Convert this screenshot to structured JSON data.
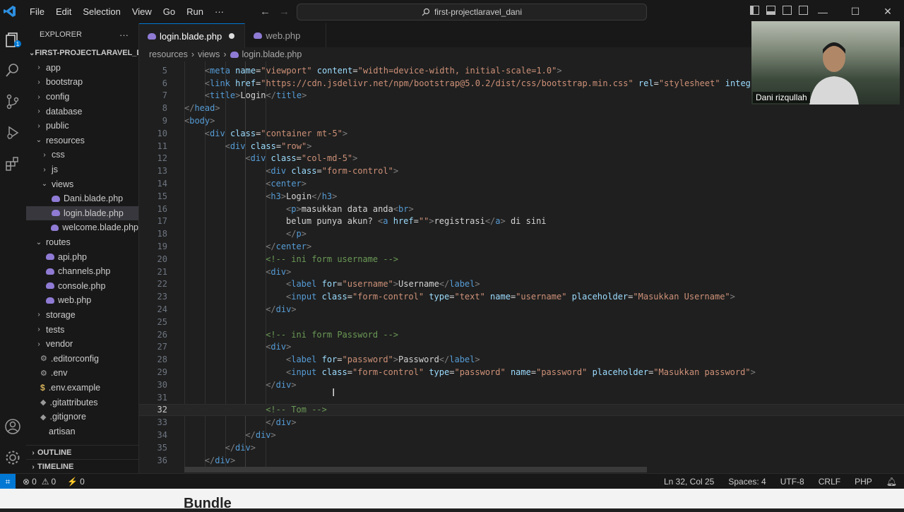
{
  "titlebar": {
    "menu": [
      "File",
      "Edit",
      "Selection",
      "View",
      "Go",
      "Run",
      "···"
    ],
    "search": "first-projectlaravel_dani"
  },
  "sidebar": {
    "title": "EXPLORER",
    "more": "···",
    "project": "FIRST-PROJECTLARAVEL_D...",
    "items": [
      {
        "label": "app",
        "indent": 1,
        "kind": "folder",
        "open": false
      },
      {
        "label": "bootstrap",
        "indent": 1,
        "kind": "folder",
        "open": false
      },
      {
        "label": "config",
        "indent": 1,
        "kind": "folder",
        "open": false
      },
      {
        "label": "database",
        "indent": 1,
        "kind": "folder",
        "open": false
      },
      {
        "label": "public",
        "indent": 1,
        "kind": "folder",
        "open": false
      },
      {
        "label": "resources",
        "indent": 1,
        "kind": "folder",
        "open": true
      },
      {
        "label": "css",
        "indent": 2,
        "kind": "folder",
        "open": false
      },
      {
        "label": "js",
        "indent": 2,
        "kind": "folder",
        "open": false
      },
      {
        "label": "views",
        "indent": 2,
        "kind": "folder",
        "open": true
      },
      {
        "label": "Dani.blade.php",
        "indent": 3,
        "kind": "php"
      },
      {
        "label": "login.blade.php",
        "indent": 3,
        "kind": "php",
        "selected": true
      },
      {
        "label": "welcome.blade.php",
        "indent": 3,
        "kind": "php"
      },
      {
        "label": "routes",
        "indent": 1,
        "kind": "folder",
        "open": true
      },
      {
        "label": "api.php",
        "indent": 2,
        "kind": "php"
      },
      {
        "label": "channels.php",
        "indent": 2,
        "kind": "php"
      },
      {
        "label": "console.php",
        "indent": 2,
        "kind": "php"
      },
      {
        "label": "web.php",
        "indent": 2,
        "kind": "php"
      },
      {
        "label": "storage",
        "indent": 1,
        "kind": "folder",
        "open": false
      },
      {
        "label": "tests",
        "indent": 1,
        "kind": "folder",
        "open": false
      },
      {
        "label": "vendor",
        "indent": 1,
        "kind": "folder",
        "open": false
      },
      {
        "label": ".editorconfig",
        "indent": 1,
        "kind": "gear"
      },
      {
        "label": ".env",
        "indent": 1,
        "kind": "gear"
      },
      {
        "label": ".env.example",
        "indent": 1,
        "kind": "dollar"
      },
      {
        "label": ".gitattributes",
        "indent": 1,
        "kind": "git"
      },
      {
        "label": ".gitignore",
        "indent": 1,
        "kind": "git"
      },
      {
        "label": "artisan",
        "indent": 1,
        "kind": "plain"
      }
    ],
    "outline": "OUTLINE",
    "timeline": "TIMELINE"
  },
  "tabs": [
    {
      "label": "login.blade.php",
      "active": true,
      "modified": true
    },
    {
      "label": "web.php",
      "active": false,
      "modified": false
    }
  ],
  "breadcrumb": [
    "resources",
    "views",
    "login.blade.php"
  ],
  "code": [
    {
      "n": "5",
      "indent": 1,
      "tokens": [
        [
          "br",
          "<"
        ],
        [
          "tg",
          "meta "
        ],
        [
          "at",
          "name"
        ],
        [
          "eq",
          "="
        ],
        [
          "st",
          "\"viewport\" "
        ],
        [
          "at",
          "content"
        ],
        [
          "eq",
          "="
        ],
        [
          "st",
          "\"width=device-width, initial-scale=1.0\""
        ],
        [
          "br",
          ">"
        ]
      ]
    },
    {
      "n": "6",
      "indent": 1,
      "tokens": [
        [
          "br",
          "<"
        ],
        [
          "tg",
          "link "
        ],
        [
          "at",
          "href"
        ],
        [
          "eq",
          "="
        ],
        [
          "st",
          "\"https://cdn.jsdelivr.net/npm/bootstrap@5.0.2/dist/css/bootstrap.min.css\" "
        ],
        [
          "at",
          "rel"
        ],
        [
          "eq",
          "="
        ],
        [
          "st",
          "\"stylesheet\" "
        ],
        [
          "at",
          "integ"
        ]
      ]
    },
    {
      "n": "7",
      "indent": 1,
      "tokens": [
        [
          "br",
          "<"
        ],
        [
          "tg",
          "title"
        ],
        [
          "br",
          ">"
        ],
        [
          "txt",
          "Login"
        ],
        [
          "br",
          "</"
        ],
        [
          "tg",
          "title"
        ],
        [
          "br",
          ">"
        ]
      ]
    },
    {
      "n": "8",
      "indent": 0,
      "tokens": [
        [
          "br",
          "</"
        ],
        [
          "tg",
          "head"
        ],
        [
          "br",
          ">"
        ]
      ]
    },
    {
      "n": "9",
      "indent": 0,
      "tokens": [
        [
          "br",
          "<"
        ],
        [
          "tg",
          "body"
        ],
        [
          "br",
          ">"
        ]
      ]
    },
    {
      "n": "10",
      "indent": 1,
      "tokens": [
        [
          "br",
          "<"
        ],
        [
          "tg",
          "div "
        ],
        [
          "at",
          "class"
        ],
        [
          "eq",
          "="
        ],
        [
          "st",
          "\"container mt-5\""
        ],
        [
          "br",
          ">"
        ]
      ]
    },
    {
      "n": "11",
      "indent": 2,
      "tokens": [
        [
          "br",
          "<"
        ],
        [
          "tg",
          "div "
        ],
        [
          "at",
          "class"
        ],
        [
          "eq",
          "="
        ],
        [
          "st",
          "\"row\""
        ],
        [
          "br",
          ">"
        ]
      ]
    },
    {
      "n": "12",
      "indent": 3,
      "tokens": [
        [
          "br",
          "<"
        ],
        [
          "tg",
          "div "
        ],
        [
          "at",
          "class"
        ],
        [
          "eq",
          "="
        ],
        [
          "st",
          "\"col-md-5\""
        ],
        [
          "br",
          ">"
        ]
      ]
    },
    {
      "n": "13",
      "indent": 4,
      "tokens": [
        [
          "br",
          "<"
        ],
        [
          "tg",
          "div "
        ],
        [
          "at",
          "class"
        ],
        [
          "eq",
          "="
        ],
        [
          "st",
          "\"form-control\""
        ],
        [
          "br",
          ">"
        ]
      ]
    },
    {
      "n": "14",
      "indent": 4,
      "tokens": [
        [
          "br",
          "<"
        ],
        [
          "tg",
          "center"
        ],
        [
          "br",
          ">"
        ]
      ]
    },
    {
      "n": "15",
      "indent": 4,
      "tokens": [
        [
          "br",
          "<"
        ],
        [
          "tg",
          "h3"
        ],
        [
          "br",
          ">"
        ],
        [
          "txt",
          "Login"
        ],
        [
          "br",
          "</"
        ],
        [
          "tg",
          "h3"
        ],
        [
          "br",
          ">"
        ]
      ]
    },
    {
      "n": "16",
      "indent": 5,
      "tokens": [
        [
          "br",
          "<"
        ],
        [
          "tg",
          "p"
        ],
        [
          "br",
          ">"
        ],
        [
          "txt",
          "masukkan data anda"
        ],
        [
          "br",
          "<"
        ],
        [
          "tg",
          "br"
        ],
        [
          "br",
          ">"
        ]
      ]
    },
    {
      "n": "17",
      "indent": 5,
      "tokens": [
        [
          "txt",
          "belum punya akun? "
        ],
        [
          "br",
          "<"
        ],
        [
          "tg",
          "a "
        ],
        [
          "at",
          "href"
        ],
        [
          "eq",
          "="
        ],
        [
          "st",
          "\"\""
        ],
        [
          "br",
          ">"
        ],
        [
          "txt",
          "registrasi"
        ],
        [
          "br",
          "</"
        ],
        [
          "tg",
          "a"
        ],
        [
          "br",
          "> "
        ],
        [
          "txt",
          "di sini"
        ]
      ]
    },
    {
      "n": "18",
      "indent": 5,
      "tokens": [
        [
          "br",
          "</"
        ],
        [
          "tg",
          "p"
        ],
        [
          "br",
          ">"
        ]
      ]
    },
    {
      "n": "19",
      "indent": 4,
      "tokens": [
        [
          "br",
          "</"
        ],
        [
          "tg",
          "center"
        ],
        [
          "br",
          ">"
        ]
      ]
    },
    {
      "n": "20",
      "indent": 4,
      "tokens": [
        [
          "cm",
          "<!-- ini form username -->"
        ]
      ]
    },
    {
      "n": "21",
      "indent": 4,
      "tokens": [
        [
          "br",
          "<"
        ],
        [
          "tg",
          "div"
        ],
        [
          "br",
          ">"
        ]
      ]
    },
    {
      "n": "22",
      "indent": 5,
      "tokens": [
        [
          "br",
          "<"
        ],
        [
          "tg",
          "label "
        ],
        [
          "at",
          "for"
        ],
        [
          "eq",
          "="
        ],
        [
          "st",
          "\"username\""
        ],
        [
          "br",
          ">"
        ],
        [
          "txt",
          "Username"
        ],
        [
          "br",
          "</"
        ],
        [
          "tg",
          "label"
        ],
        [
          "br",
          ">"
        ]
      ]
    },
    {
      "n": "23",
      "indent": 5,
      "tokens": [
        [
          "br",
          "<"
        ],
        [
          "tg",
          "input "
        ],
        [
          "at",
          "class"
        ],
        [
          "eq",
          "="
        ],
        [
          "st",
          "\"form-control\" "
        ],
        [
          "at",
          "type"
        ],
        [
          "eq",
          "="
        ],
        [
          "st",
          "\"text\" "
        ],
        [
          "at",
          "name"
        ],
        [
          "eq",
          "="
        ],
        [
          "st",
          "\"username\" "
        ],
        [
          "at",
          "placeholder"
        ],
        [
          "eq",
          "="
        ],
        [
          "st",
          "\"Masukkan Username\""
        ],
        [
          "br",
          ">"
        ]
      ]
    },
    {
      "n": "24",
      "indent": 4,
      "tokens": [
        [
          "br",
          "</"
        ],
        [
          "tg",
          "div"
        ],
        [
          "br",
          ">"
        ]
      ]
    },
    {
      "n": "25",
      "indent": 0,
      "tokens": []
    },
    {
      "n": "26",
      "indent": 4,
      "tokens": [
        [
          "cm",
          "<!-- ini form Password -->"
        ]
      ]
    },
    {
      "n": "27",
      "indent": 4,
      "tokens": [
        [
          "br",
          "<"
        ],
        [
          "tg",
          "div"
        ],
        [
          "br",
          ">"
        ]
      ]
    },
    {
      "n": "28",
      "indent": 5,
      "tokens": [
        [
          "br",
          "<"
        ],
        [
          "tg",
          "label "
        ],
        [
          "at",
          "for"
        ],
        [
          "eq",
          "="
        ],
        [
          "st",
          "\"password\""
        ],
        [
          "br",
          ">"
        ],
        [
          "txt",
          "Password"
        ],
        [
          "br",
          "</"
        ],
        [
          "tg",
          "label"
        ],
        [
          "br",
          ">"
        ]
      ]
    },
    {
      "n": "29",
      "indent": 5,
      "tokens": [
        [
          "br",
          "<"
        ],
        [
          "tg",
          "input "
        ],
        [
          "at",
          "class"
        ],
        [
          "eq",
          "="
        ],
        [
          "st",
          "\"form-control\" "
        ],
        [
          "at",
          "type"
        ],
        [
          "eq",
          "="
        ],
        [
          "st",
          "\"password\" "
        ],
        [
          "at",
          "name"
        ],
        [
          "eq",
          "="
        ],
        [
          "st",
          "\"password\" "
        ],
        [
          "at",
          "placeholder"
        ],
        [
          "eq",
          "="
        ],
        [
          "st",
          "\"Masukkan password\""
        ],
        [
          "br",
          ">"
        ]
      ]
    },
    {
      "n": "30",
      "indent": 4,
      "tokens": [
        [
          "br",
          "</"
        ],
        [
          "tg",
          "div"
        ],
        [
          "br",
          ">"
        ]
      ]
    },
    {
      "n": "31",
      "indent": 0,
      "tokens": []
    },
    {
      "n": "32",
      "indent": 4,
      "current": true,
      "tokens": [
        [
          "cm",
          "<!-- Tom -->"
        ]
      ]
    },
    {
      "n": "33",
      "indent": 4,
      "tokens": [
        [
          "br",
          "</"
        ],
        [
          "tg",
          "div"
        ],
        [
          "br",
          ">"
        ]
      ]
    },
    {
      "n": "34",
      "indent": 3,
      "tokens": [
        [
          "br",
          "</"
        ],
        [
          "tg",
          "div"
        ],
        [
          "br",
          ">"
        ]
      ]
    },
    {
      "n": "35",
      "indent": 2,
      "tokens": [
        [
          "br",
          "</"
        ],
        [
          "tg",
          "div"
        ],
        [
          "br",
          ">"
        ]
      ]
    },
    {
      "n": "36",
      "indent": 1,
      "tokens": [
        [
          "br",
          "</"
        ],
        [
          "tg",
          "div"
        ],
        [
          "br",
          ">"
        ]
      ]
    }
  ],
  "status": {
    "errors": "0",
    "warnings": "0",
    "ports": "0",
    "position": "Ln 32, Col 25",
    "spaces": "Spaces: 4",
    "encoding": "UTF-8",
    "eol": "CRLF",
    "language": "PHP"
  },
  "webcam": {
    "name": "Dani rizqullah"
  },
  "bottom_text": "Bundle",
  "colors": {
    "accent": "#0078d4",
    "tag": "#569cd6",
    "attr": "#9cdcfe",
    "string": "#ce9178",
    "comment": "#6a9955"
  }
}
